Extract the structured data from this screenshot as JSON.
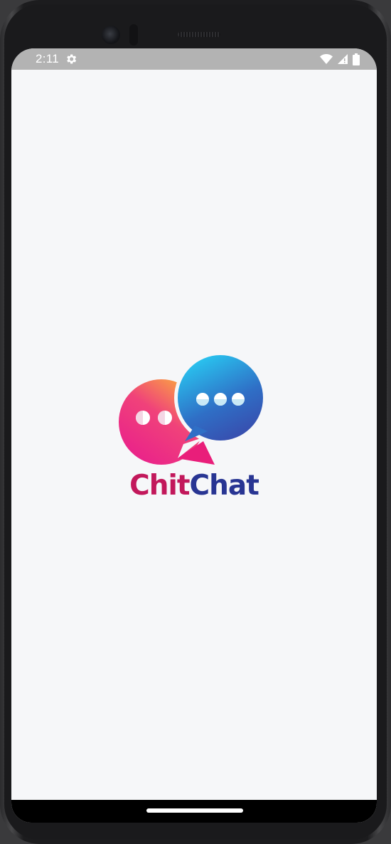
{
  "status_bar": {
    "time": "2:11",
    "icons": [
      "settings-gear-icon",
      "wifi-icon",
      "cellular-signal-icon",
      "battery-icon"
    ]
  },
  "splash": {
    "brand_part1": "Chit",
    "brand_part2": "Chat",
    "logo_icon": "chat-bubbles-logo-icon"
  },
  "colors": {
    "brand_pink": "#c2185b",
    "brand_navy": "#283593",
    "bubble_pink_start": "#fbb03b",
    "bubble_pink_end": "#e91e63",
    "bubble_blue_start": "#29c6f0",
    "bubble_blue_end": "#3949ab",
    "background": "#f6f7f9",
    "status_bar": "#b3b3b3"
  }
}
